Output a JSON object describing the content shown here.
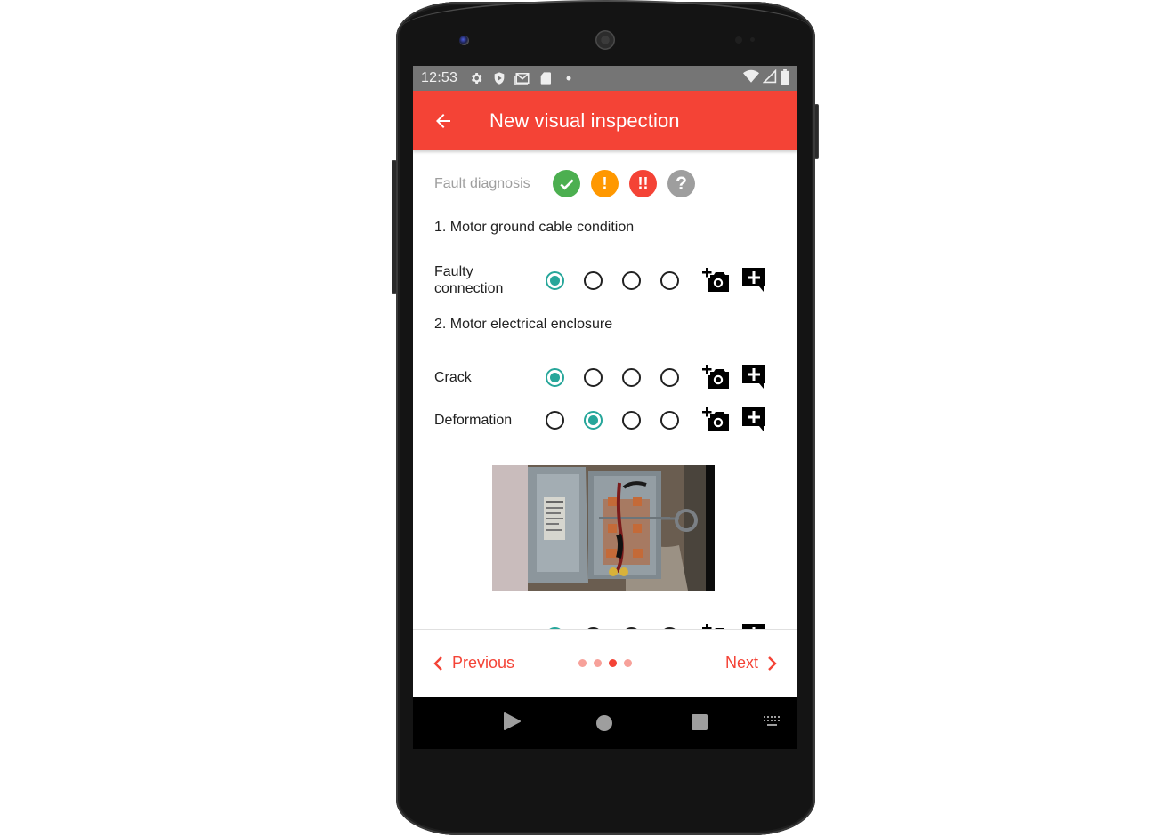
{
  "status_bar": {
    "time": "12:53",
    "left_icons": [
      "settings-icon",
      "shield-play-icon",
      "gmail-icon",
      "sd-card-icon",
      "dot-icon"
    ],
    "right_icons": [
      "wifi-icon",
      "cell-signal-icon",
      "battery-icon"
    ]
  },
  "app_bar": {
    "back_icon": "arrow-back-icon",
    "title": "New visual inspection",
    "color": "#f44336"
  },
  "legend": {
    "label": "Fault diagnosis",
    "statuses": [
      {
        "name": "ok",
        "icon": "check-icon",
        "glyph": "✓",
        "color": "#4caf50"
      },
      {
        "name": "warning",
        "icon": "exclamation-icon",
        "glyph": "!",
        "color": "#ff9800"
      },
      {
        "name": "critical",
        "icon": "double-exclamation-icon",
        "glyph": "!!",
        "color": "#f44336"
      },
      {
        "name": "unknown",
        "icon": "question-icon",
        "glyph": "?",
        "color": "#9e9e9e"
      }
    ]
  },
  "sections": [
    {
      "title": "1. Motor ground cable condition",
      "items": [
        {
          "label": "Faulty connection",
          "selected": 0
        }
      ]
    },
    {
      "title": "2. Motor electrical enclosure",
      "items": [
        {
          "label": "Crack",
          "selected": 0
        },
        {
          "label": "Deformation",
          "selected": 1
        }
      ]
    }
  ],
  "partial_row": {
    "selected": 0
  },
  "photo": {
    "alt": "Open electrical disconnect enclosure with wiring"
  },
  "actions": {
    "add_photo_icon": "add-photo-icon",
    "add_comment_icon": "add-comment-icon"
  },
  "radio_accent": "#26a69a",
  "bottom_nav": {
    "previous_label": "Previous",
    "next_label": "Next",
    "page_count": 4,
    "current_page": 3
  },
  "system_nav": {
    "back_icon": "nav-back-icon",
    "home_icon": "nav-home-icon",
    "recents_icon": "nav-recents-icon",
    "keyboard_icon": "keyboard-icon"
  }
}
